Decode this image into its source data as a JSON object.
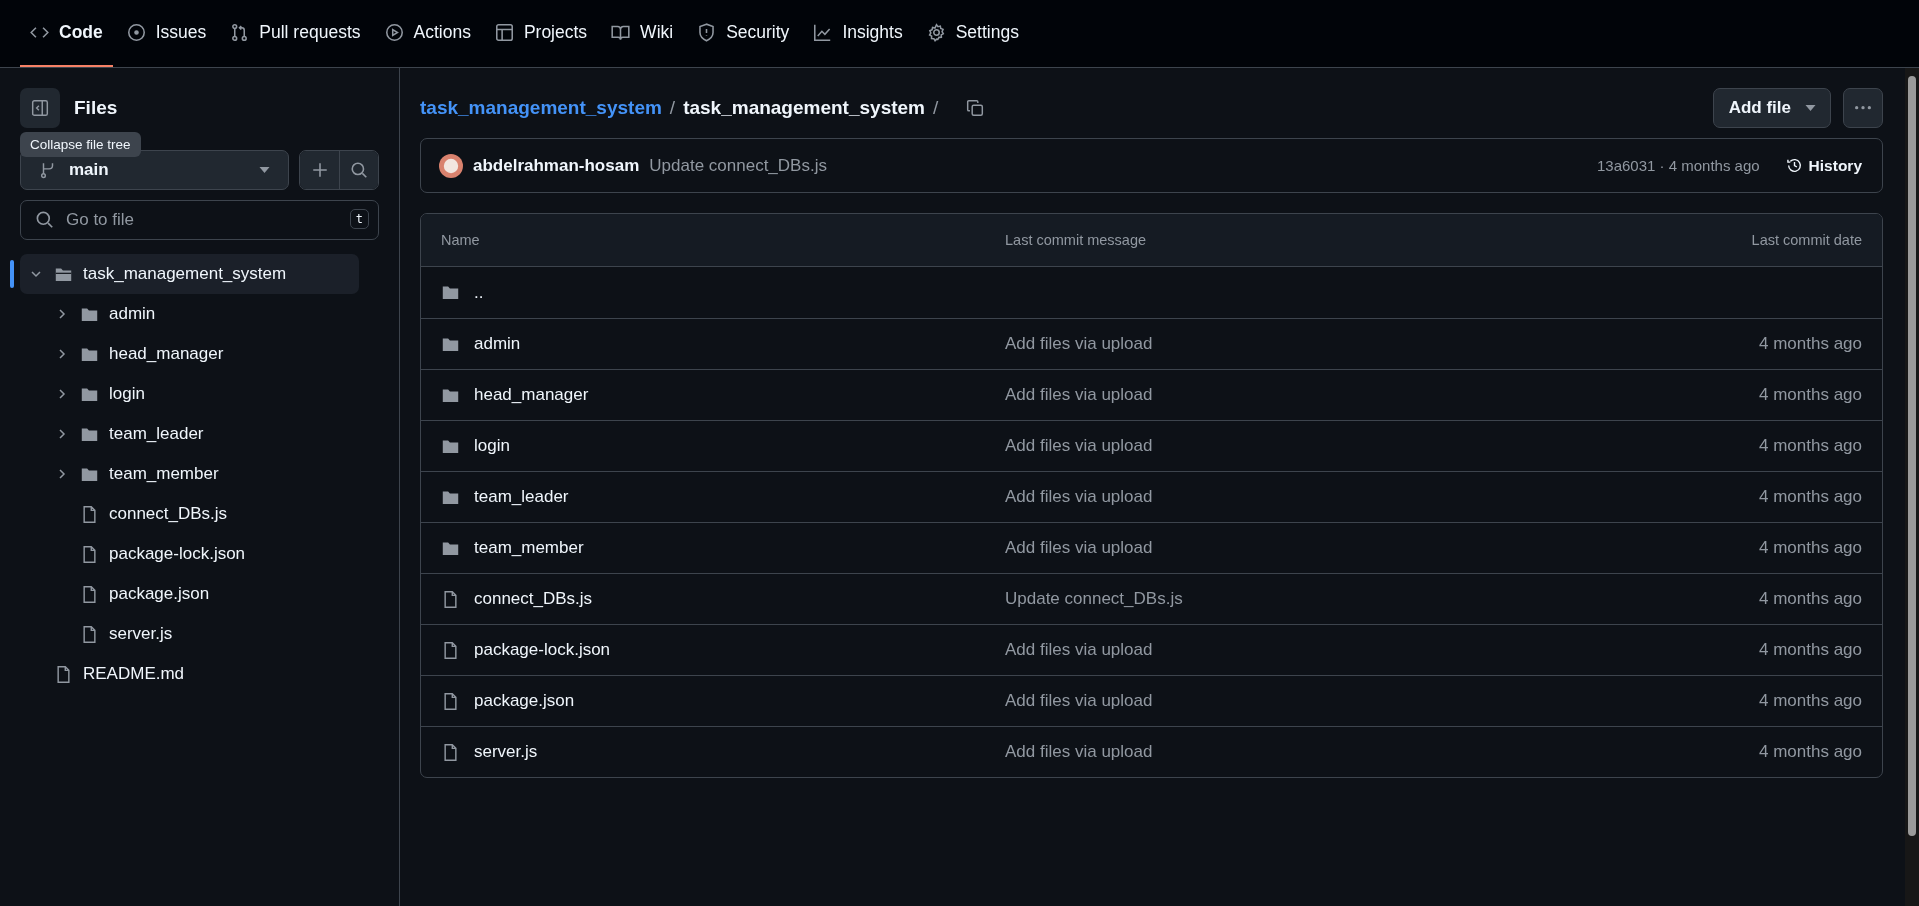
{
  "nav_tabs": [
    {
      "label": "Code",
      "selected": true
    },
    {
      "label": "Issues",
      "selected": false
    },
    {
      "label": "Pull requests",
      "selected": false
    },
    {
      "label": "Actions",
      "selected": false
    },
    {
      "label": "Projects",
      "selected": false
    },
    {
      "label": "Wiki",
      "selected": false
    },
    {
      "label": "Security",
      "selected": false
    },
    {
      "label": "Insights",
      "selected": false
    },
    {
      "label": "Settings",
      "selected": false
    }
  ],
  "sidebar": {
    "title": "Files",
    "tooltip": "Collapse file tree",
    "branch": "main",
    "search": {
      "placeholder": "Go to file",
      "shortcut": "t"
    },
    "tree": [
      {
        "name": "task_management_system",
        "kind": "folder",
        "expanded": true,
        "selected": true,
        "children": [
          {
            "name": "admin",
            "kind": "folder",
            "expanded": false,
            "selected": false
          },
          {
            "name": "head_manager",
            "kind": "folder",
            "expanded": false,
            "selected": false
          },
          {
            "name": "login",
            "kind": "folder",
            "expanded": false,
            "selected": false
          },
          {
            "name": "team_leader",
            "kind": "folder",
            "expanded": false,
            "selected": false
          },
          {
            "name": "team_member",
            "kind": "folder",
            "expanded": false,
            "selected": false
          },
          {
            "name": "connect_DBs.js",
            "kind": "file",
            "selected": false
          },
          {
            "name": "package-lock.json",
            "kind": "file",
            "selected": false
          },
          {
            "name": "package.json",
            "kind": "file",
            "selected": false
          },
          {
            "name": "server.js",
            "kind": "file",
            "selected": false
          }
        ]
      },
      {
        "name": "README.md",
        "kind": "file",
        "selected": false
      }
    ]
  },
  "breadcrumb": {
    "repo": "task_management_system",
    "folder": "task_management_system",
    "separator": "/"
  },
  "add_file_button": "Add file",
  "latest_commit": {
    "author": "abdelrahman-hosam",
    "message": "Update connect_DBs.js",
    "meta": "13a6031 · 4 months ago",
    "history": "History"
  },
  "table": {
    "columns": [
      "Name",
      "Last commit message",
      "Last commit date"
    ],
    "rows": [
      {
        "kind": "parent",
        "name": "..",
        "message": "",
        "date": ""
      },
      {
        "kind": "folder",
        "name": "admin",
        "message": "Add files via upload",
        "date": "4 months ago"
      },
      {
        "kind": "folder",
        "name": "head_manager",
        "message": "Add files via upload",
        "date": "4 months ago"
      },
      {
        "kind": "folder",
        "name": "login",
        "message": "Add files via upload",
        "date": "4 months ago"
      },
      {
        "kind": "folder",
        "name": "team_leader",
        "message": "Add files via upload",
        "date": "4 months ago"
      },
      {
        "kind": "folder",
        "name": "team_member",
        "message": "Add files via upload",
        "date": "4 months ago"
      },
      {
        "kind": "file",
        "name": "connect_DBs.js",
        "message": "Update connect_DBs.js",
        "date": "4 months ago"
      },
      {
        "kind": "file",
        "name": "package-lock.json",
        "message": "Add files via upload",
        "date": "4 months ago"
      },
      {
        "kind": "file",
        "name": "package.json",
        "message": "Add files via upload",
        "date": "4 months ago"
      },
      {
        "kind": "file",
        "name": "server.js",
        "message": "Add files via upload",
        "date": "4 months ago"
      }
    ]
  }
}
